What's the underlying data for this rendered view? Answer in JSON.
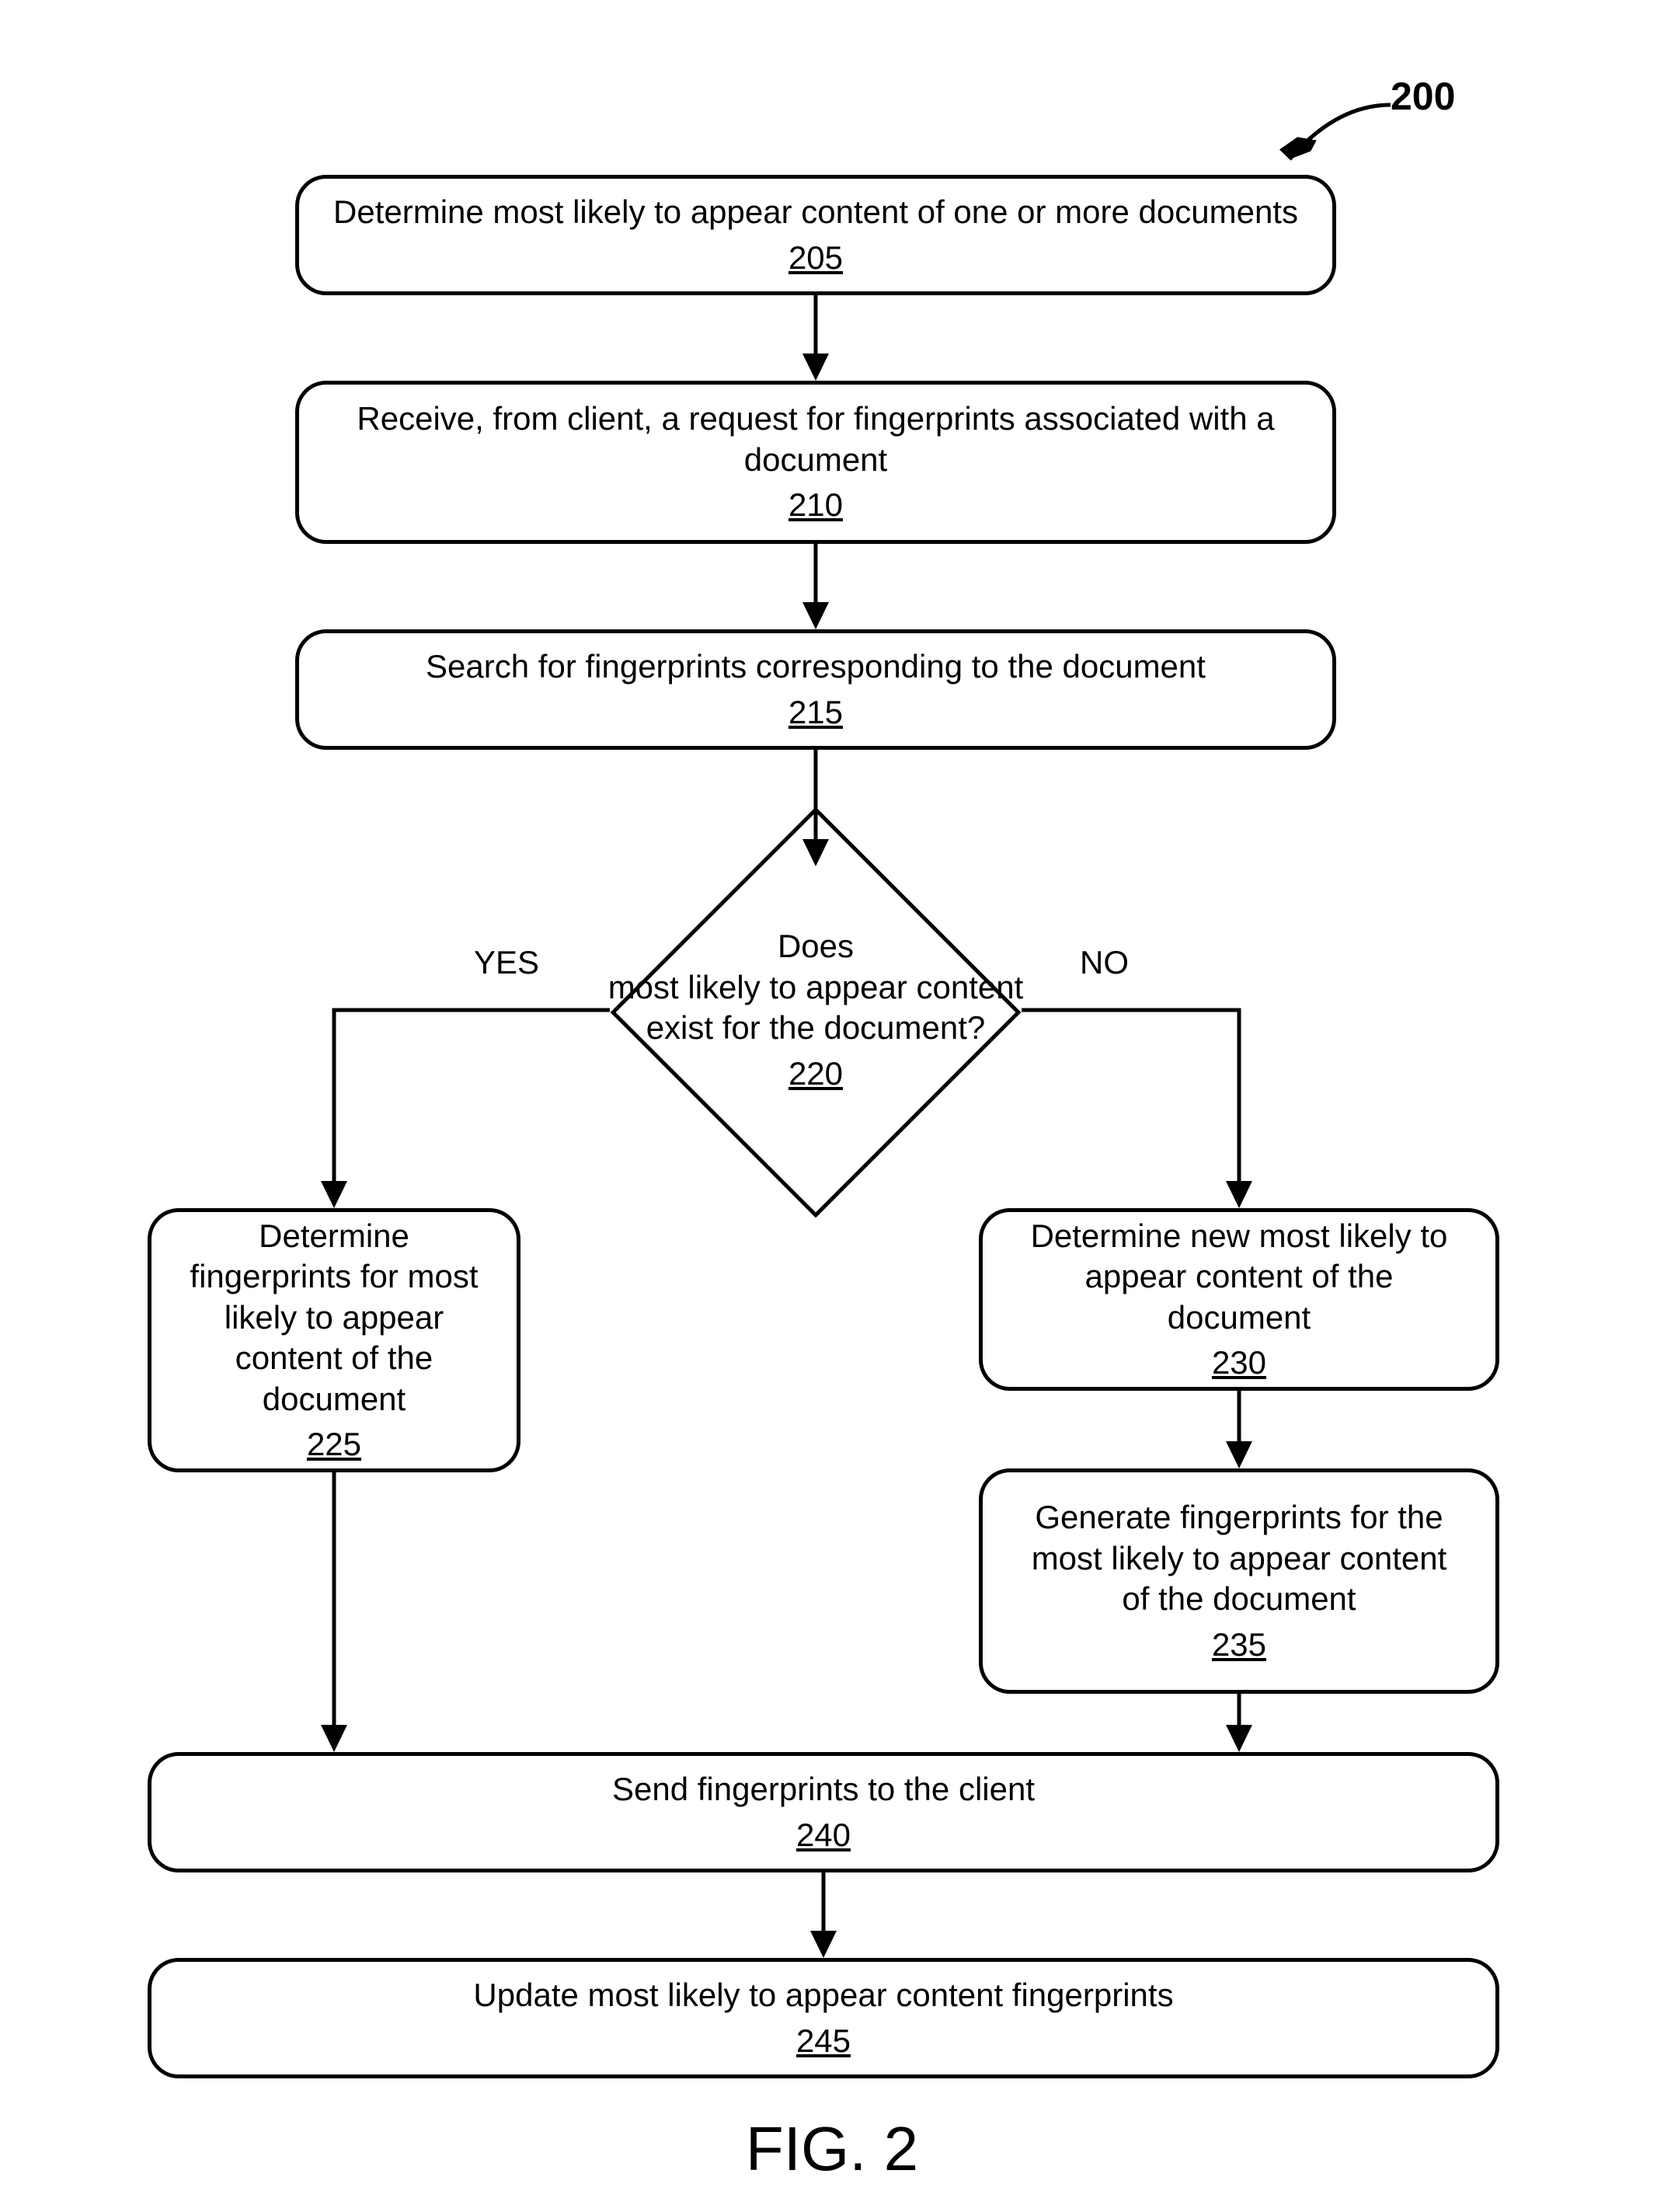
{
  "figure": {
    "reference_number": "200",
    "caption": "FIG. 2"
  },
  "nodes": {
    "n205": {
      "text": "Determine most likely to appear content of one or more documents",
      "ref": "205"
    },
    "n210": {
      "text": "Receive, from client, a request for fingerprints associated with a document",
      "ref": "210"
    },
    "n215": {
      "text": "Search for fingerprints corresponding to the document",
      "ref": "215"
    },
    "n220": {
      "line1": "Does",
      "line2": "most likely to appear content",
      "line3": "exist for the document?",
      "ref": "220"
    },
    "n225": {
      "text": "Determine fingerprints for most likely to appear content of the document",
      "ref": "225"
    },
    "n230": {
      "text": "Determine new most likely to appear content of the document",
      "ref": "230"
    },
    "n235": {
      "text": "Generate fingerprints for the most likely to appear content of the document",
      "ref": "235"
    },
    "n240": {
      "text": "Send fingerprints to the client",
      "ref": "240"
    },
    "n245": {
      "text": "Update most likely to appear content fingerprints",
      "ref": "245"
    }
  },
  "edges": {
    "yes": "YES",
    "no": "NO"
  }
}
